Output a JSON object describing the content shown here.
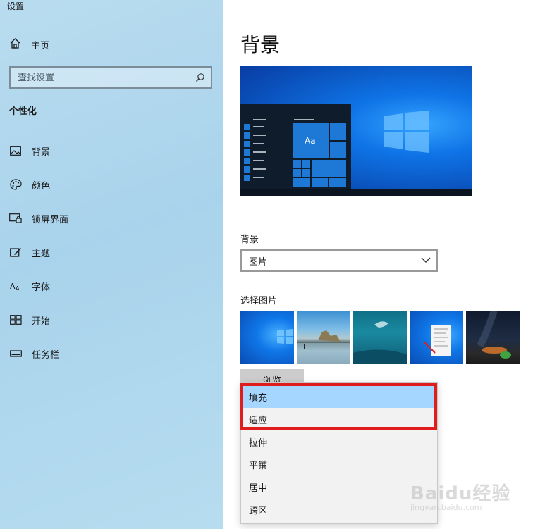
{
  "window": {
    "title": "设置"
  },
  "sidebar": {
    "home_label": "主页",
    "search_placeholder": "查找设置",
    "section_title": "个性化",
    "items": [
      {
        "label": "背景",
        "icon": "picture-icon"
      },
      {
        "label": "颜色",
        "icon": "palette-icon"
      },
      {
        "label": "锁屏界面",
        "icon": "lock-screen-icon"
      },
      {
        "label": "主题",
        "icon": "theme-icon"
      },
      {
        "label": "字体",
        "icon": "font-icon"
      },
      {
        "label": "开始",
        "icon": "start-icon"
      },
      {
        "label": "任务栏",
        "icon": "taskbar-icon"
      }
    ]
  },
  "main": {
    "title": "背景",
    "preview_tile_text": "Aa",
    "background_label": "背景",
    "background_value": "图片",
    "choose_picture_label": "选择图片",
    "browse_label": "浏览"
  },
  "fit_dropdown": {
    "options": [
      "填充",
      "适应",
      "拉伸",
      "平铺",
      "居中",
      "跨区"
    ],
    "highlighted": [
      "填充",
      "适应"
    ],
    "selected": "填充"
  },
  "colors": {
    "sidebar_bg": "#b2d8ee",
    "accent": "#0a74e6",
    "selected_option": "#a5d6ff",
    "highlight_border": "#e01d1d"
  },
  "watermark": {
    "logo": "Baidu经验",
    "url": "jingyan.baidu.com"
  }
}
